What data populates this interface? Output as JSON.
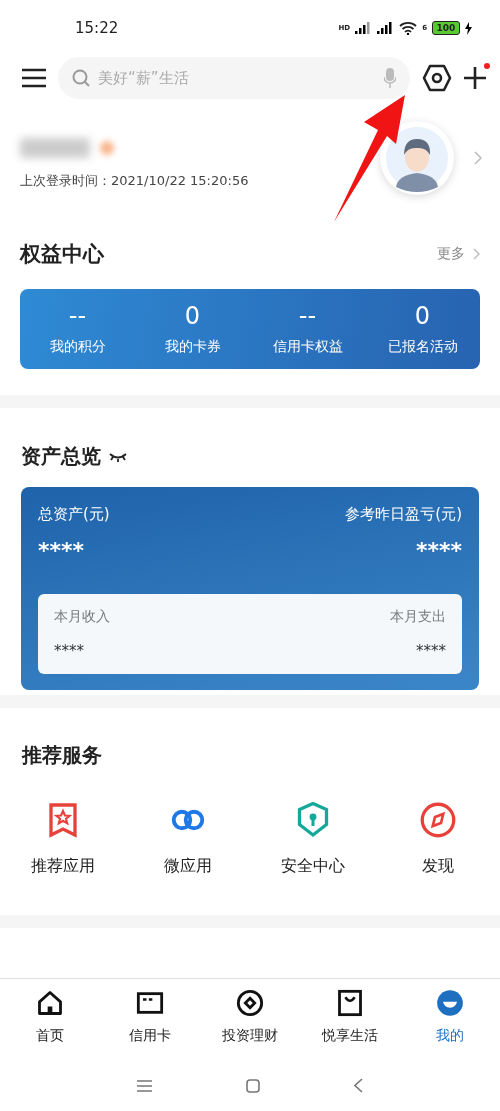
{
  "status_bar": {
    "time": "15:22",
    "signal_label": "HD",
    "wifi_label": "6",
    "battery": "100",
    "charging": true
  },
  "header": {
    "search": {
      "placeholder": "美好“薪”生活"
    },
    "notification_dot": true
  },
  "profile": {
    "last_login": "上次登录时间：2021/10/22 15:20:56"
  },
  "rights": {
    "title": "权益中心",
    "more": "更多",
    "items": [
      {
        "value": "--",
        "label": "我的积分"
      },
      {
        "value": "0",
        "label": "我的卡券"
      },
      {
        "value": "--",
        "label": "信用卡权益"
      },
      {
        "value": "0",
        "label": "已报名活动"
      }
    ]
  },
  "assets": {
    "title": "资产总览",
    "total_label": "总资产(元)",
    "total_value": "****",
    "pnl_label": "参考昨日盈亏(元)",
    "pnl_value": "****",
    "income_label": "本月收入",
    "income_value": "****",
    "expense_label": "本月支出",
    "expense_value": "****"
  },
  "services": {
    "title": "推荐服务",
    "items": [
      {
        "kind": "bookmark",
        "label": "推荐应用"
      },
      {
        "kind": "link",
        "label": "微应用"
      },
      {
        "kind": "shield",
        "label": "安全中心"
      },
      {
        "kind": "compass",
        "label": "发现"
      }
    ]
  },
  "tabs": [
    {
      "kind": "home",
      "label": "首页",
      "selected": false
    },
    {
      "kind": "card",
      "label": "信用卡",
      "selected": false
    },
    {
      "kind": "invest",
      "label": "投资理财",
      "selected": false
    },
    {
      "kind": "bag",
      "label": "悦享生活",
      "selected": false
    },
    {
      "kind": "me",
      "label": "我的",
      "selected": true
    }
  ]
}
